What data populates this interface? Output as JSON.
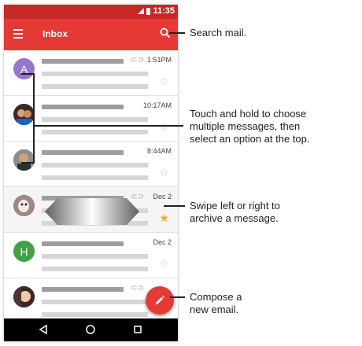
{
  "status_bar": {
    "time": "11:35"
  },
  "app_bar": {
    "title": "Inbox",
    "menu_icon": "menu-icon",
    "search_icon": "search-icon"
  },
  "messages": [
    {
      "avatar_letter": "A",
      "avatar_color": "#9575cd",
      "time": "1:51PM",
      "attachment": true,
      "starred": false
    },
    {
      "avatar_letter": "",
      "avatar_color": "#6d4c41",
      "time": "10:17AM",
      "attachment": false,
      "starred": false
    },
    {
      "avatar_letter": "",
      "avatar_color": "#5d4037",
      "time": "8:44AM",
      "attachment": false,
      "starred": false
    },
    {
      "avatar_letter": "",
      "avatar_color": "#8d6e63",
      "time": "Dec 2",
      "attachment": true,
      "starred": true
    },
    {
      "avatar_letter": "H",
      "avatar_color": "#43a047",
      "time": "Dec 2",
      "attachment": false,
      "starred": false
    },
    {
      "avatar_letter": "",
      "avatar_color": "#4e342e",
      "time": "",
      "attachment": true,
      "starred": false
    }
  ],
  "nav_bar": {
    "back_icon": "back-icon",
    "home_icon": "home-icon",
    "recents_icon": "recents-icon"
  },
  "fab": {
    "icon": "pencil-icon"
  },
  "callouts": {
    "search": "Search mail.",
    "select_line1": "Touch and hold to choose",
    "select_line2": "multiple messages, then",
    "select_line3": "select an option at the top.",
    "swipe_line1": "Swipe left or right to",
    "swipe_line2": "archive a message.",
    "compose_line1": "Compose a",
    "compose_line2": "new email."
  },
  "colors": {
    "status_bar": "#c62828",
    "app_bar": "#e53935",
    "fab": "#e53935",
    "star_active": "#f9a825"
  }
}
